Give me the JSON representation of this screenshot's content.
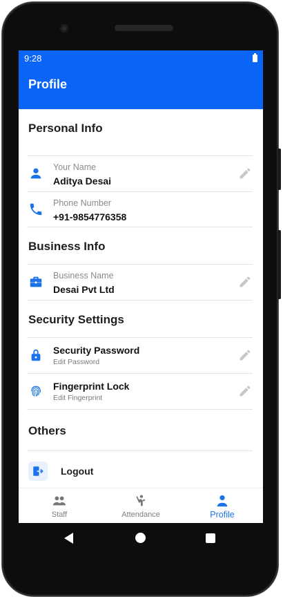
{
  "status_bar": {
    "time": "9:28"
  },
  "appbar": {
    "title": "Profile"
  },
  "sections": {
    "personal": "Personal Info",
    "business": "Business Info",
    "security": "Security Settings",
    "others": "Others"
  },
  "personal": {
    "name_label": "Your Name",
    "name_value": "Aditya Desai",
    "phone_label": "Phone Number",
    "phone_value": "+91-9854776358"
  },
  "business": {
    "name_label": "Business Name",
    "name_value": "Desai Pvt Ltd"
  },
  "security": {
    "password_title": "Security Password",
    "password_sub": "Edit Password",
    "fingerprint_title": "Fingerprint Lock",
    "fingerprint_sub": "Edit Fingerprint"
  },
  "others": {
    "logout": "Logout"
  },
  "bottom_nav": [
    {
      "label": "Staff",
      "icon": "people-icon",
      "active": false
    },
    {
      "label": "Attendance",
      "icon": "attendance-icon",
      "active": false
    },
    {
      "label": "Profile",
      "icon": "person-icon",
      "active": true
    }
  ],
  "colors": {
    "primary": "#0a64f5",
    "active_tab": "#1a73e8",
    "icon_blue": "#1a73e8"
  }
}
